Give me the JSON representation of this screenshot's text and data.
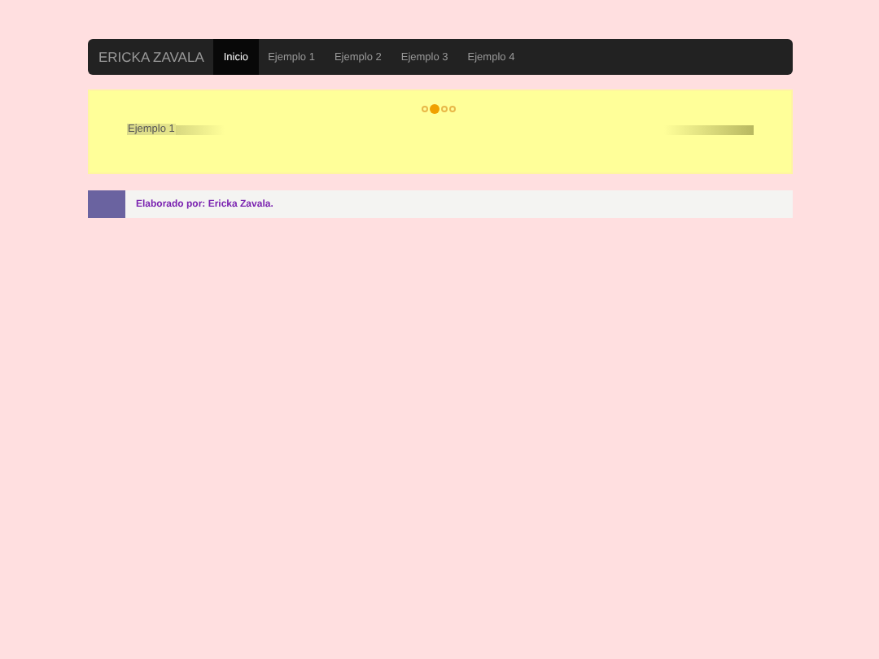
{
  "navbar": {
    "brand": "ERICKA ZAVALA",
    "items": [
      {
        "label": "Inicio",
        "selected": true
      },
      {
        "label": "Ejemplo 1",
        "selected": false
      },
      {
        "label": "Ejemplo 2",
        "selected": false
      },
      {
        "label": "Ejemplo 3",
        "selected": false
      },
      {
        "label": "Ejemplo 4",
        "selected": false
      }
    ]
  },
  "carousel": {
    "indicators": [
      {
        "selected": false
      },
      {
        "selected": true
      },
      {
        "selected": false
      },
      {
        "selected": false
      }
    ],
    "caption": "Ejemplo 1"
  },
  "footer": {
    "text": "Elaborado por: Ericka Zavala."
  }
}
